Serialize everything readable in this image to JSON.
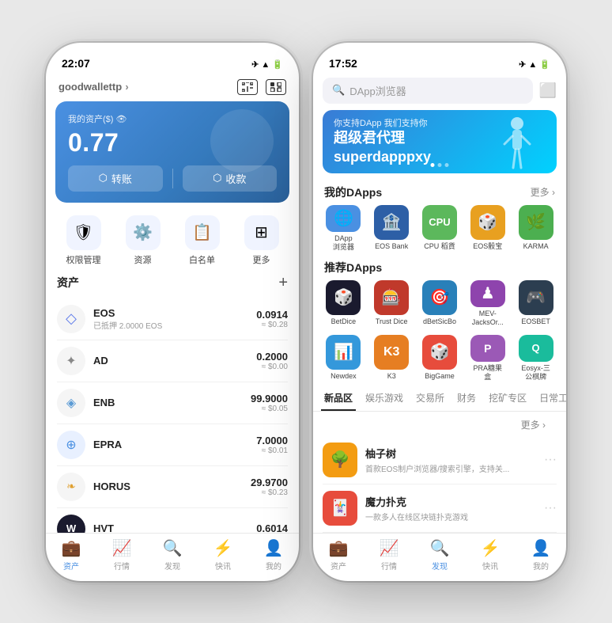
{
  "left_phone": {
    "status_time": "22:07",
    "status_icons": "✈ ▲ 🔋",
    "wallet_name": "goodwallettp",
    "wallet_chevron": ">",
    "balance_label": "我的资产($) 👁",
    "balance_amount": "0.77",
    "btn_transfer": "转账",
    "btn_receive": "收款",
    "quick_items": [
      {
        "icon": "🛡",
        "label": "权限管理"
      },
      {
        "icon": "⚙",
        "label": "资源"
      },
      {
        "icon": "📋",
        "label": "白名单"
      },
      {
        "icon": "⊞",
        "label": "更多"
      }
    ],
    "assets_title": "资产",
    "add_icon": "+",
    "assets": [
      {
        "icon": "◇",
        "name": "EOS",
        "sub": "已抵押 2.0000 EOS",
        "amount": "0.0914",
        "usd": "≈ $0.28"
      },
      {
        "icon": "✦",
        "name": "AD",
        "sub": "",
        "amount": "0.2000",
        "usd": "≈ $0.00"
      },
      {
        "icon": "◈",
        "name": "ENB",
        "sub": "",
        "amount": "99.9000",
        "usd": "≈ $0.05"
      },
      {
        "icon": "⊕",
        "name": "EPRA",
        "sub": "",
        "amount": "7.0000",
        "usd": "≈ $0.01"
      },
      {
        "icon": "❧",
        "name": "HORUS",
        "sub": "",
        "amount": "29.9700",
        "usd": "≈ $0.23"
      },
      {
        "icon": "W",
        "name": "HVT",
        "sub": "",
        "amount": "0.6014",
        "usd": ""
      }
    ],
    "nav_items": [
      {
        "icon": "💼",
        "label": "资产",
        "active": true
      },
      {
        "icon": "📈",
        "label": "行情",
        "active": false
      },
      {
        "icon": "🔍",
        "label": "发现",
        "active": false
      },
      {
        "icon": "⚡",
        "label": "快讯",
        "active": false
      },
      {
        "icon": "👤",
        "label": "我的",
        "active": false
      }
    ]
  },
  "right_phone": {
    "status_time": "17:52",
    "status_icons": "✈ ▲ 🔋",
    "search_placeholder": "DApp浏览器",
    "scan_icon": "⬜",
    "banner_sub": "你支持DApp 我们支持你",
    "banner_title1": "超级君代理",
    "banner_title2": "superdapppxy",
    "my_dapps_title": "我的DApps",
    "more_label": "更多 >",
    "my_dapps": [
      {
        "icon": "🌐",
        "name": "DApp\n浏览器",
        "bg": "#4a90e2"
      },
      {
        "icon": "🏦",
        "name": "EOS Bank",
        "bg": "#2d6cb4"
      },
      {
        "icon": "💻",
        "name": "CPU 稻貨",
        "bg": "#5cb85c"
      },
      {
        "icon": "🎲",
        "name": "EOS骰宝",
        "bg": "#e8a020"
      },
      {
        "icon": "🌿",
        "name": "KARMA",
        "bg": "#4caf50"
      }
    ],
    "rec_dapps_title": "推荐DApps",
    "rec_dapps": [
      {
        "icon": "🎲",
        "name": "BetDice",
        "bg": "#1a1a2e"
      },
      {
        "icon": "🎰",
        "name": "Trust Dice",
        "bg": "#c0392b"
      },
      {
        "icon": "🎯",
        "name": "dBetSicBo",
        "bg": "#2980b9"
      },
      {
        "icon": "♟",
        "name": "MEV-\nJacksOr...",
        "bg": "#8e44ad"
      },
      {
        "icon": "🎮",
        "name": "EOSBET",
        "bg": "#2c3e50"
      },
      {
        "icon": "📊",
        "name": "Newdex",
        "bg": "#3498db"
      },
      {
        "icon": "K",
        "name": "K3",
        "bg": "#e67e22"
      },
      {
        "icon": "🎲",
        "name": "BigGame",
        "bg": "#e74c3c"
      },
      {
        "icon": "P",
        "name": "PRA糖果\n盒",
        "bg": "#9b59b6"
      },
      {
        "icon": "Q",
        "name": "Eosyx-三\n公棋牌",
        "bg": "#1abc9c"
      }
    ],
    "tabs": [
      {
        "label": "新品区",
        "active": true
      },
      {
        "label": "娱乐游戏",
        "active": false
      },
      {
        "label": "交易所",
        "active": false
      },
      {
        "label": "财务",
        "active": false
      },
      {
        "label": "挖矿专区",
        "active": false
      },
      {
        "label": "日常工...",
        "active": false
      }
    ],
    "new_apps_more": "更多 >",
    "new_apps": [
      {
        "icon": "🌳",
        "name": "柚子树",
        "desc": "首款EOS制户浏览器/搜索引擎，支持关...",
        "bg": "#f39c12"
      },
      {
        "icon": "🃏",
        "name": "魔力扑克",
        "desc": "一款多人在线区块链扑克游戏",
        "bg": "#e74c3c"
      }
    ],
    "nav_items": [
      {
        "icon": "💼",
        "label": "资产",
        "active": false
      },
      {
        "icon": "📈",
        "label": "行情",
        "active": false
      },
      {
        "icon": "🔍",
        "label": "发现",
        "active": true
      },
      {
        "icon": "⚡",
        "label": "快讯",
        "active": false
      },
      {
        "icon": "👤",
        "label": "我的",
        "active": false
      }
    ]
  }
}
